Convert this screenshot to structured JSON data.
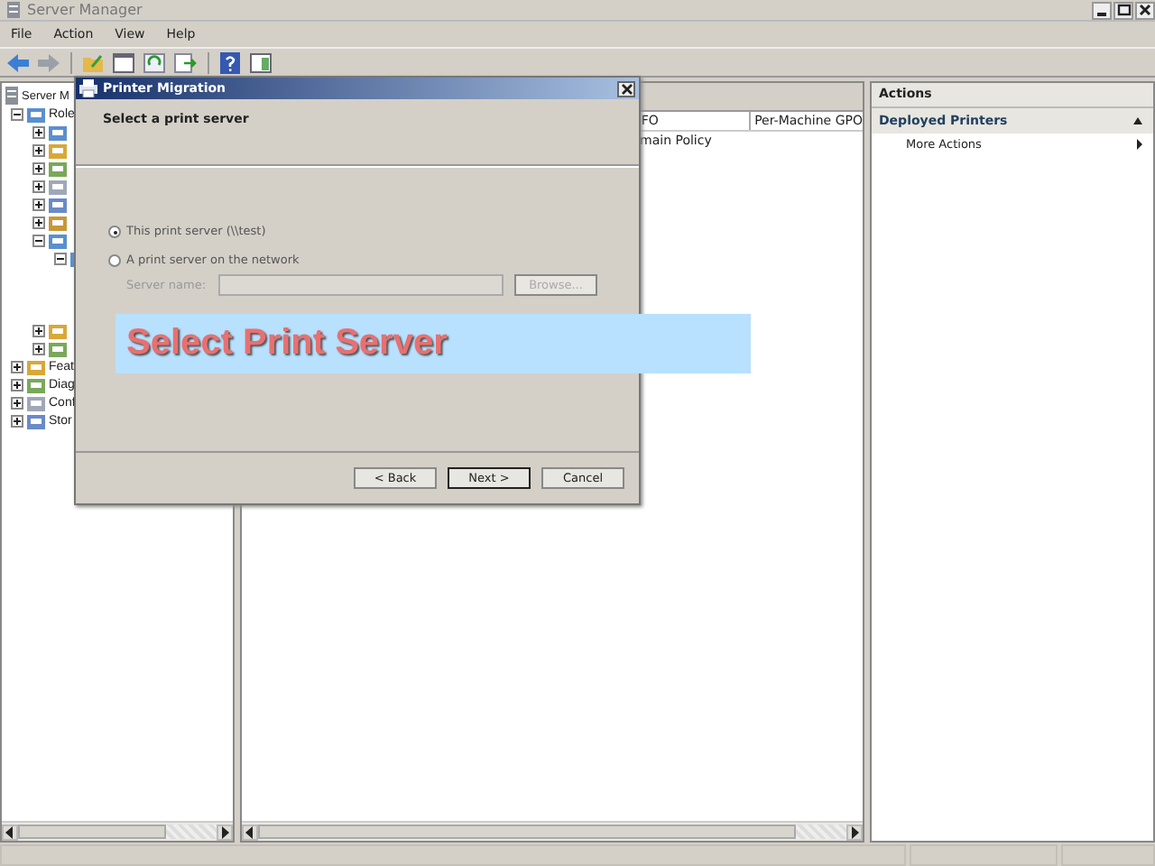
{
  "window": {
    "title": "Server Manager"
  },
  "menu": [
    {
      "label": "File"
    },
    {
      "label": "Action"
    },
    {
      "label": "View"
    },
    {
      "label": "Help"
    }
  ],
  "tree": [
    {
      "label": "Server M",
      "children": [
        {
          "label": "Role",
          "expanded": true,
          "children": [
            {
              "expanded": false
            },
            {
              "expanded": false
            },
            {
              "expanded": false
            },
            {
              "expanded": false
            },
            {
              "expanded": false
            },
            {
              "expanded": false
            },
            {
              "expanded": true,
              "children": [
                {
                  "expanded": true
                }
              ]
            },
            {
              "expanded": false
            },
            {
              "expanded": false
            }
          ]
        },
        {
          "label": "Feat",
          "expanded": false
        },
        {
          "label": "Diag",
          "expanded": false
        },
        {
          "label": "Conf",
          "expanded": false
        },
        {
          "label": "Stor",
          "expanded": false
        }
      ]
    }
  ],
  "center": {
    "columns": [
      {
        "label": "FO"
      },
      {
        "label": "Per-Machine GPO"
      }
    ],
    "rows": [
      [
        "main Policy",
        ""
      ]
    ]
  },
  "actions": {
    "title": "Actions",
    "section": "Deployed Printers",
    "items": [
      {
        "label": "More Actions"
      }
    ]
  },
  "dialog": {
    "title": "Printer Migration",
    "heading": "Select a print server",
    "options": [
      {
        "label": "This print server (\\\\test)",
        "selected": true
      },
      {
        "label": "A print server on the network",
        "selected": false
      }
    ],
    "server_name": {
      "label": "Server name:",
      "disabled": true
    },
    "browse": {
      "label": "Browse...",
      "disabled": true
    },
    "buttons": [
      {
        "label": "< Back",
        "default": false
      },
      {
        "label": "Next >",
        "default": true
      },
      {
        "label": "Cancel",
        "default": false
      }
    ]
  },
  "banner": {
    "text": "Select Print Server"
  }
}
